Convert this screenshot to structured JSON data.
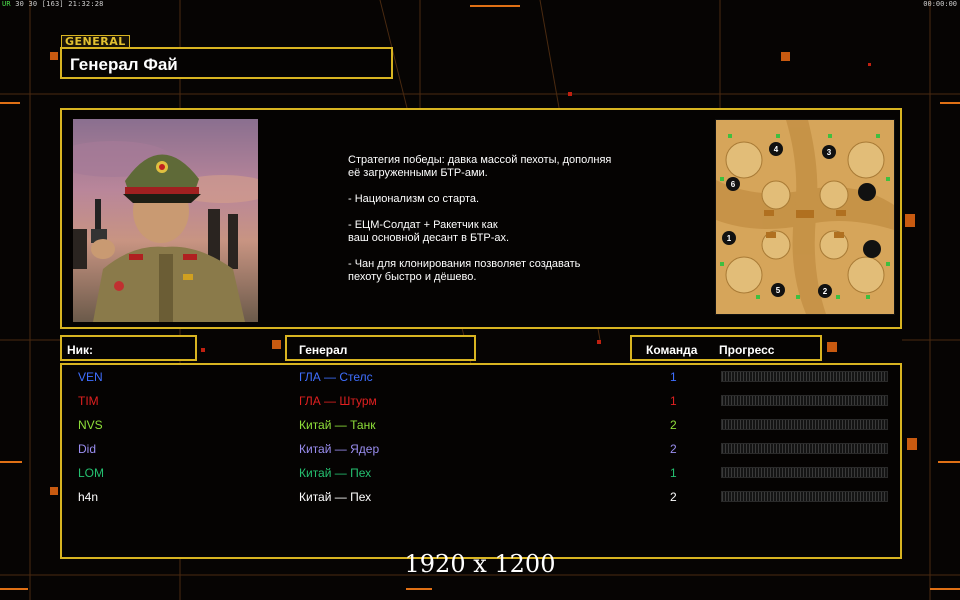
{
  "status": {
    "fps_label": "UR",
    "fps_values": "30 30",
    "fps_extra": "[163]",
    "clock": "21:32:28",
    "timer": "00:00:00"
  },
  "general_tag": "GENERAL",
  "general_name": "Генерал Фай",
  "description": [
    "Стратегия победы: давка массой пехоты, дополняя\n её загруженными БТР-ами.",
    "- Национализм со старта.",
    "- ЕЦМ-Солдат + Ракетчик как\nваш основной десант в БТР-ах.",
    "- Чан для клонирования позволяет создавать\n пехоту быстро и дёшево."
  ],
  "map": {
    "spawns": [
      "1",
      "2",
      "3",
      "4",
      "5",
      "6"
    ]
  },
  "headers": {
    "nick": "Ник:",
    "general": "Генерал",
    "team": "Команда",
    "progress": "Прогресс"
  },
  "players": [
    {
      "nick": "VEN",
      "general": "ГЛА — Стелс",
      "team": "1",
      "nick_color": "#3f6fff",
      "general_color": "#3f6fff",
      "progress": 0
    },
    {
      "nick": "TIM",
      "general": "ГЛА — Штурм",
      "team": "1",
      "nick_color": "#e02020",
      "general_color": "#e02020",
      "progress": 0
    },
    {
      "nick": "NVS",
      "general": "Китай — Танк",
      "team": "2",
      "nick_color": "#8fe03a",
      "general_color": "#8fe03a",
      "progress": 0
    },
    {
      "nick": "Did",
      "general": "Китай — Ядер",
      "team": "2",
      "nick_color": "#9a8ef0",
      "general_color": "#9a8ef0",
      "progress": 0
    },
    {
      "nick": "LOM",
      "general": "Китай — Пех",
      "team": "1",
      "nick_color": "#25c070",
      "general_color": "#25c070",
      "progress": 0
    },
    {
      "nick": "h4n",
      "general": "Китай — Пех",
      "team": "2",
      "nick_color": "#ffffff",
      "general_color": "#ffffff",
      "progress": 0
    }
  ],
  "resolution_label": "1920 x 1200",
  "colors": {
    "accent": "#d8b421",
    "team_1": "#3f6fff",
    "team_2": "#ffffff"
  }
}
